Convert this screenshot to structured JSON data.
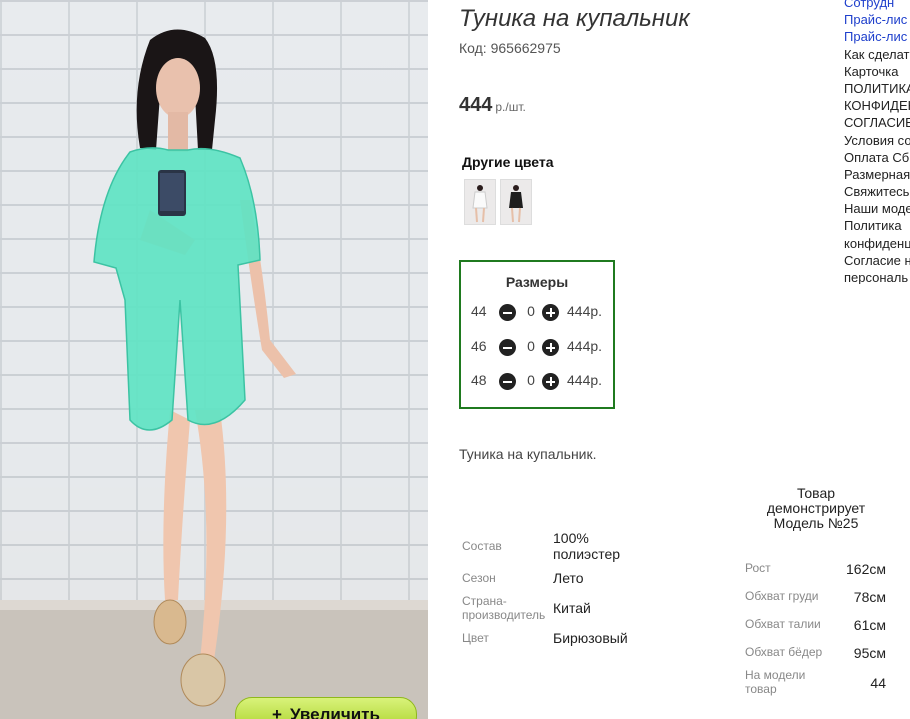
{
  "product": {
    "title": "Туника на купальник",
    "code": "Код: 965662975",
    "price": "444",
    "price_unit": "р./шт.",
    "other_colors_heading": "Другие цвета",
    "zoom_button": "Увеличить",
    "zoom_button_icon": "+",
    "description": "Туника на купальник."
  },
  "sizes": {
    "heading": "Размеры",
    "rows": [
      {
        "size": "44",
        "qty": "0",
        "price": "444р."
      },
      {
        "size": "46",
        "qty": "0",
        "price": "444р."
      },
      {
        "size": "48",
        "qty": "0",
        "price": "444р."
      }
    ]
  },
  "attributes": [
    {
      "label": "Состав",
      "value": "100% полиэстер"
    },
    {
      "label": "Сезон",
      "value": "Лето"
    },
    {
      "label": "Страна-производитель",
      "value": "Китай"
    },
    {
      "label": "Цвет",
      "value": "Бирюзовый"
    }
  ],
  "model": {
    "heading": "Товар демонстрирует Модель №25",
    "rows": [
      {
        "label": "Рост",
        "value": "162см"
      },
      {
        "label": "Обхват груди",
        "value": "78см"
      },
      {
        "label": "Обхват талии",
        "value": "61см"
      },
      {
        "label": "Обхват бёдер",
        "value": "95см"
      },
      {
        "label": "На модели товар",
        "value": "44"
      }
    ]
  },
  "sidebar": {
    "items": [
      "Сотрудн",
      "Прайс-лис",
      "Прайс-лис",
      "Как сделат",
      "Карточка",
      "ПОЛИТИКА",
      "КОНФИДЕН",
      "СОГЛАСИЕ",
      "Условия со",
      "Оплата Сб",
      "Размерная",
      "Свяжитесь",
      "Наши моде",
      "Политика",
      "конфиденц",
      "Согласие н",
      "персональ"
    ]
  },
  "colors": {
    "frame_green": "#1f7a1f",
    "link_blue": "#1e3fcc",
    "tunic": "#5fe3c3",
    "button_green": "#a9d32a"
  }
}
